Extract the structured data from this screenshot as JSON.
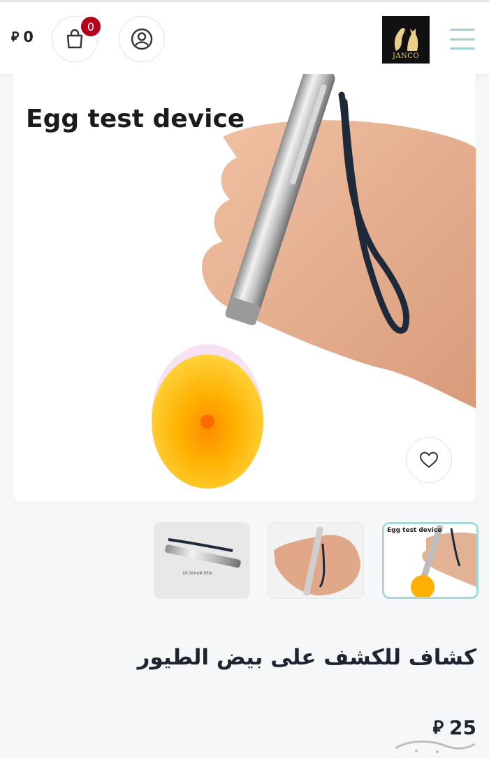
{
  "header": {
    "cart_total": "0",
    "currency_symbol": "⃁",
    "cart_badge_count": "0",
    "logo_text": "JANCO"
  },
  "main_image": {
    "caption": "Egg test device"
  },
  "thumbnails": [
    {
      "caption": "Egg test device",
      "active": true
    },
    {
      "caption": "",
      "active": false
    },
    {
      "caption": "",
      "active": false
    }
  ],
  "product": {
    "title": "كشاف للكشف على بيض الطيور",
    "price": "25",
    "currency_symbol": "⃁"
  },
  "colors": {
    "badge": "#b3001b",
    "accent": "#a7d8dc",
    "text": "#1f2430"
  }
}
